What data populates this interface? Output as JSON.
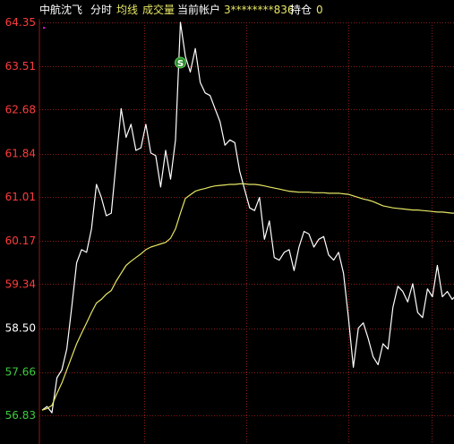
{
  "header": {
    "stock_name": "中航沈飞",
    "tab_intraday": "分时",
    "ma_label": "均线",
    "volume_label": "成交量",
    "account_label": "当前帐户",
    "account_value": "3********836",
    "position_label": "持仓",
    "position_value": "0"
  },
  "colors": {
    "background": "#000000",
    "price_line": "#ffffff",
    "avg_line": "#e6e664",
    "up": "#ff3c3c",
    "down": "#3ccc3c",
    "flat": "#ffffff",
    "grid": "#8b1a1a",
    "marker": "#2e8b2e"
  },
  "marker": {
    "label": "S",
    "x_index": 28,
    "price": 63.58
  },
  "chart_data": {
    "type": "line",
    "title": "",
    "ylim": [
      56.83,
      64.35
    ],
    "prev_close": 58.5,
    "ticks": [
      {
        "value": 64.35,
        "label": "64.35",
        "color": "up"
      },
      {
        "value": 63.51,
        "label": "63.51",
        "color": "up"
      },
      {
        "value": 62.68,
        "label": "62.68",
        "color": "up"
      },
      {
        "value": 61.84,
        "label": "61.84",
        "color": "up"
      },
      {
        "value": 61.01,
        "label": "61.01",
        "color": "up"
      },
      {
        "value": 60.17,
        "label": "60.17",
        "color": "up"
      },
      {
        "value": 59.34,
        "label": "59.34",
        "color": "up"
      },
      {
        "value": 58.5,
        "label": "58.50",
        "color": "flat"
      },
      {
        "value": 57.66,
        "label": "57.66",
        "color": "down"
      },
      {
        "value": 56.83,
        "label": "56.83",
        "color": "down"
      }
    ],
    "x_count": 84,
    "series": [
      {
        "name": "price",
        "values": [
          56.93,
          57.0,
          56.88,
          57.55,
          57.7,
          58.1,
          58.9,
          59.75,
          60.0,
          59.95,
          60.4,
          61.25,
          61.0,
          60.65,
          60.7,
          61.7,
          62.7,
          62.15,
          62.4,
          61.9,
          61.95,
          62.4,
          61.85,
          61.8,
          61.2,
          61.9,
          61.35,
          62.1,
          64.35,
          63.7,
          63.4,
          63.85,
          63.2,
          63.0,
          62.95,
          62.7,
          62.45,
          62.0,
          62.1,
          62.05,
          61.5,
          61.15,
          60.8,
          60.75,
          61.0,
          60.2,
          60.55,
          59.85,
          59.8,
          59.95,
          60.0,
          59.6,
          60.05,
          60.35,
          60.3,
          60.05,
          60.2,
          60.25,
          59.9,
          59.8,
          59.95,
          59.55,
          58.7,
          57.75,
          58.5,
          58.6,
          58.3,
          57.95,
          57.8,
          58.2,
          58.1,
          58.9,
          59.3,
          59.2,
          59.0,
          59.35,
          58.8,
          58.7,
          59.25,
          59.1,
          59.7,
          59.1,
          59.2,
          59.05,
          59.15,
          58.75,
          58.85,
          58.8
        ]
      },
      {
        "name": "avg",
        "values": [
          56.93,
          56.96,
          57.02,
          57.25,
          57.45,
          57.7,
          57.95,
          58.2,
          58.4,
          58.6,
          58.8,
          58.98,
          59.05,
          59.15,
          59.22,
          59.4,
          59.55,
          59.7,
          59.78,
          59.85,
          59.92,
          60.0,
          60.05,
          60.08,
          60.11,
          60.14,
          60.22,
          60.4,
          60.7,
          60.98,
          61.05,
          61.12,
          61.15,
          61.17,
          61.2,
          61.22,
          61.23,
          61.24,
          61.25,
          61.25,
          61.26,
          61.26,
          61.25,
          61.25,
          61.24,
          61.22,
          61.2,
          61.18,
          61.16,
          61.14,
          61.12,
          61.11,
          61.1,
          61.1,
          61.1,
          61.09,
          61.09,
          61.09,
          61.08,
          61.08,
          61.08,
          61.07,
          61.06,
          61.03,
          61.0,
          60.97,
          60.95,
          60.92,
          60.88,
          60.84,
          60.82,
          60.8,
          60.79,
          60.78,
          60.77,
          60.76,
          60.76,
          60.75,
          60.74,
          60.73,
          60.72,
          60.72,
          60.71,
          60.7,
          60.7,
          60.7,
          60.69,
          60.69
        ]
      }
    ]
  }
}
